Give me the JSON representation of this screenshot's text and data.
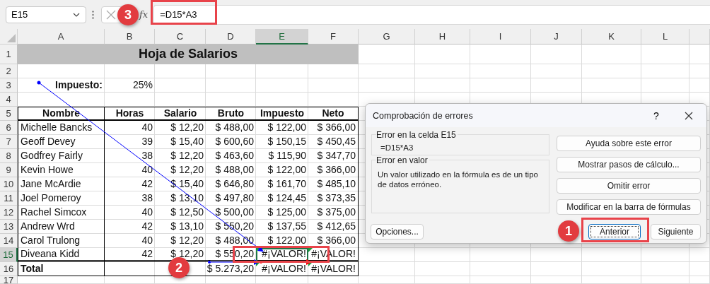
{
  "formula_bar": {
    "name_box": "E15",
    "fx": "fx",
    "formula": "=D15*A3"
  },
  "column_headers": [
    {
      "label": "A",
      "selected": false
    },
    {
      "label": "B",
      "selected": false
    },
    {
      "label": "C",
      "selected": false
    },
    {
      "label": "D",
      "selected": false
    },
    {
      "label": "E",
      "selected": true
    },
    {
      "label": "F",
      "selected": false
    },
    {
      "label": "G",
      "selected": false
    },
    {
      "label": "H",
      "selected": false
    },
    {
      "label": "I",
      "selected": false
    },
    {
      "label": "J",
      "selected": false
    },
    {
      "label": "K",
      "selected": false
    },
    {
      "label": "L",
      "selected": false
    }
  ],
  "row_headers": [
    {
      "label": "1",
      "selected": false
    },
    {
      "label": "2",
      "selected": false
    },
    {
      "label": "3",
      "selected": false
    },
    {
      "label": "4",
      "selected": false
    },
    {
      "label": "5",
      "selected": false
    },
    {
      "label": "6",
      "selected": false
    },
    {
      "label": "7",
      "selected": false
    },
    {
      "label": "8",
      "selected": false
    },
    {
      "label": "9",
      "selected": false
    },
    {
      "label": "10",
      "selected": false
    },
    {
      "label": "11",
      "selected": false
    },
    {
      "label": "12",
      "selected": false
    },
    {
      "label": "13",
      "selected": false
    },
    {
      "label": "14",
      "selected": false
    },
    {
      "label": "15",
      "selected": true
    },
    {
      "label": "16",
      "selected": false
    },
    {
      "label": "17",
      "selected": false
    }
  ],
  "sheet": {
    "title": "Hoja de Salarios",
    "tax_label": "Impuesto:",
    "tax_value": "25%",
    "columns": [
      "Nombre",
      "Horas",
      "Salario",
      "Bruto",
      "Impuesto",
      "Neto"
    ],
    "rows": [
      {
        "cells": [
          "Michelle Bancks",
          "40",
          "$ 12,20",
          "$ 488,00",
          "$ 122,00",
          "$ 366,00"
        ],
        "error": false
      },
      {
        "cells": [
          "Geoff Devey",
          "39",
          "$ 15,40",
          "$ 600,60",
          "$ 150,15",
          "$ 450,45"
        ],
        "error": false
      },
      {
        "cells": [
          "Godfrey Fairly",
          "38",
          "$ 12,20",
          "$ 463,60",
          "$ 115,90",
          "$ 347,70"
        ],
        "error": false
      },
      {
        "cells": [
          "Kevin Howe",
          "40",
          "$ 12,20",
          "$ 488,00",
          "$ 122,00",
          "$ 366,00"
        ],
        "error": false
      },
      {
        "cells": [
          "Jane McArdie",
          "42",
          "$ 15,40",
          "$ 646,80",
          "$ 161,70",
          "$ 485,10"
        ],
        "error": false
      },
      {
        "cells": [
          "Joel Pomeroy",
          "38",
          "$ 13,10",
          "$ 497,80",
          "$ 124,45",
          "$ 373,35"
        ],
        "error": false
      },
      {
        "cells": [
          "Rachel Simcox",
          "40",
          "$ 12,50",
          "$ 500,00",
          "$ 125,00",
          "$ 375,00"
        ],
        "error": false
      },
      {
        "cells": [
          "Andrew Wrd",
          "42",
          "$ 13,10",
          "$ 550,20",
          "$ 137,55",
          "$ 412,65"
        ],
        "error": false
      },
      {
        "cells": [
          "Carol Trulong",
          "40",
          "$ 12,20",
          "$ 488,00",
          "$ 122,00",
          "$ 366,00"
        ],
        "error": false
      },
      {
        "cells": [
          "Diveana Kidd",
          "42",
          "$ 12,20",
          "$ 550,20",
          "#¡VALOR!",
          "#¡VALOR!"
        ],
        "error": true
      }
    ],
    "total": {
      "label": "Total",
      "bruto": "$ 5.273,20",
      "impuesto": "#¡VALOR!",
      "neto": "#¡VALOR!",
      "error": true
    }
  },
  "dialog": {
    "title": "Comprobación de errores",
    "help": "?",
    "groups": [
      {
        "title": "Error en la celda E15",
        "text": "=D15*A3"
      },
      {
        "title": "Error en valor",
        "text": "Un valor utilizado en la fórmula es de un tipo de datos erróneo."
      }
    ],
    "side_buttons": [
      {
        "label": "Ayuda sobre este error",
        "focused": false
      },
      {
        "label": "Mostrar pasos de cálculo...",
        "focused": false
      },
      {
        "label": "Omitir error",
        "focused": false
      },
      {
        "label": "Modificar en la barra de fórmulas",
        "focused": false
      }
    ],
    "bottom_buttons": [
      {
        "label": "Opciones...",
        "focused": false
      },
      {
        "label": "Anterior",
        "focused": true
      },
      {
        "label": "Siguiente",
        "focused": false
      }
    ]
  },
  "callouts": [
    {
      "label": "3"
    },
    {
      "label": "2"
    },
    {
      "label": "1"
    }
  ]
}
